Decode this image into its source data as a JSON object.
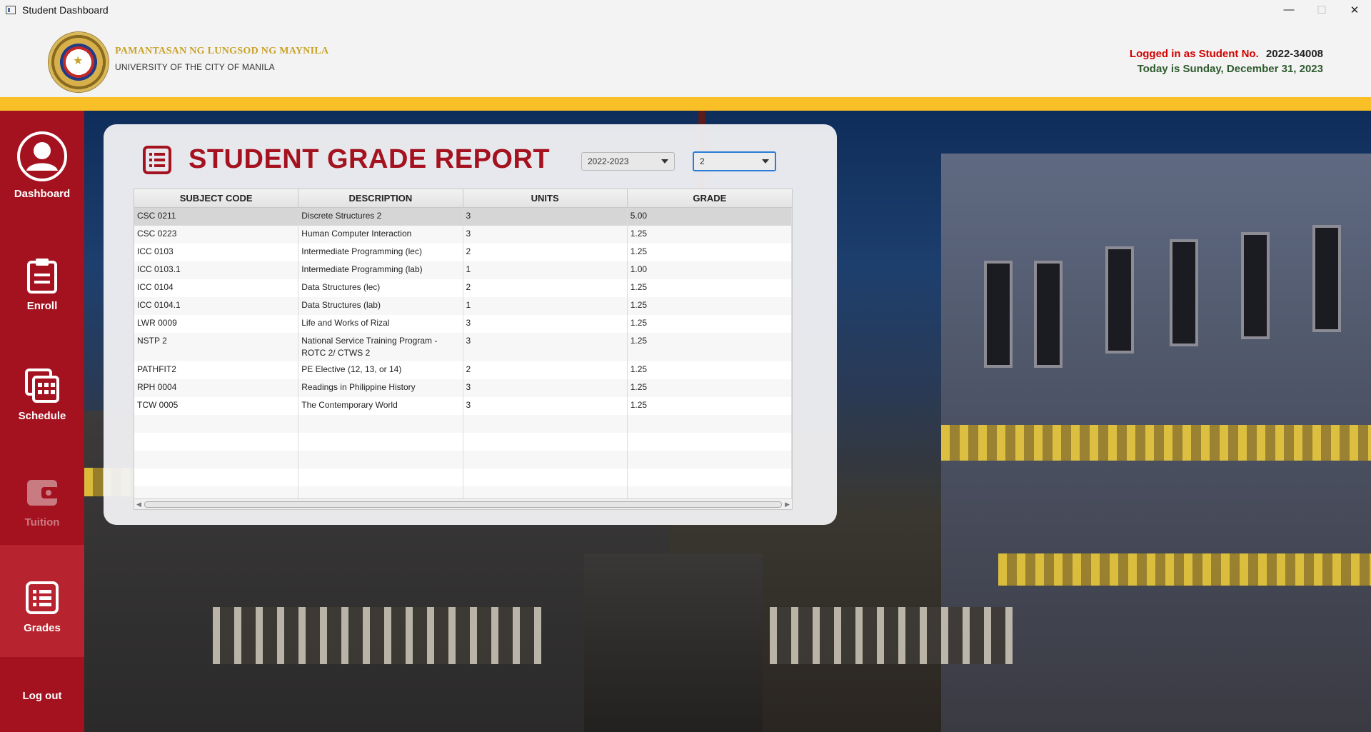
{
  "window": {
    "title": "Student Dashboard",
    "controls": {
      "minimize": "—",
      "maximize": "☐",
      "close": "✕"
    }
  },
  "header": {
    "university_name": "PAMANTASAN NG LUNGSOD NG MAYNILA",
    "university_name_en": "UNIVERSITY OF THE CITY OF MANILA",
    "logged_in_label": "Logged in as Student No.",
    "student_no": "2022-34008",
    "today": "Today is Sunday, December 31, 2023"
  },
  "sidebar": {
    "items": [
      {
        "label": "Dashboard",
        "icon": "user-avatar-icon"
      },
      {
        "label": "Enroll",
        "icon": "clipboard-icon"
      },
      {
        "label": "Schedule",
        "icon": "calendar-icon"
      },
      {
        "label": "Tuition",
        "icon": "wallet-icon",
        "state": "disabled"
      },
      {
        "label": "Grades",
        "icon": "list-icon",
        "state": "active"
      }
    ],
    "logout": "Log out"
  },
  "report": {
    "title": "STUDENT GRADE REPORT",
    "school_year": "2022-2023",
    "semester": "2",
    "columns": [
      "SUBJECT CODE",
      "DESCRIPTION",
      "UNITS",
      "GRADE"
    ],
    "rows": [
      [
        "CSC 0211",
        "Discrete Structures 2",
        "3",
        "5.00"
      ],
      [
        "CSC 0223",
        "Human Computer Interaction",
        "3",
        "1.25"
      ],
      [
        "ICC 0103",
        "Intermediate Programming (lec)",
        "2",
        "1.25"
      ],
      [
        "ICC 0103.1",
        "Intermediate Programming (lab)",
        "1",
        "1.00"
      ],
      [
        "ICC 0104",
        "Data Structures (lec)",
        "2",
        "1.25"
      ],
      [
        "ICC 0104.1",
        "Data Structures (lab)",
        "1",
        "1.25"
      ],
      [
        "LWR 0009",
        "Life and Works of Rizal",
        "3",
        "1.25"
      ],
      [
        "NSTP 2",
        "National Service Training Program -ROTC 2/ CTWS 2",
        "3",
        "1.25"
      ],
      [
        "PATHFIT2",
        "PE Elective (12, 13, or 14)",
        "2",
        "1.25"
      ],
      [
        "RPH 0004",
        "Readings in Philippine History",
        "3",
        "1.25"
      ],
      [
        "TCW 0005",
        "The Contemporary World",
        "3",
        "1.25"
      ]
    ]
  },
  "colors": {
    "sidebar_red": "#a5121f",
    "accent_yellow": "#f9bf26",
    "title_red": "#a5121f",
    "date_green": "#2e5a2e"
  }
}
